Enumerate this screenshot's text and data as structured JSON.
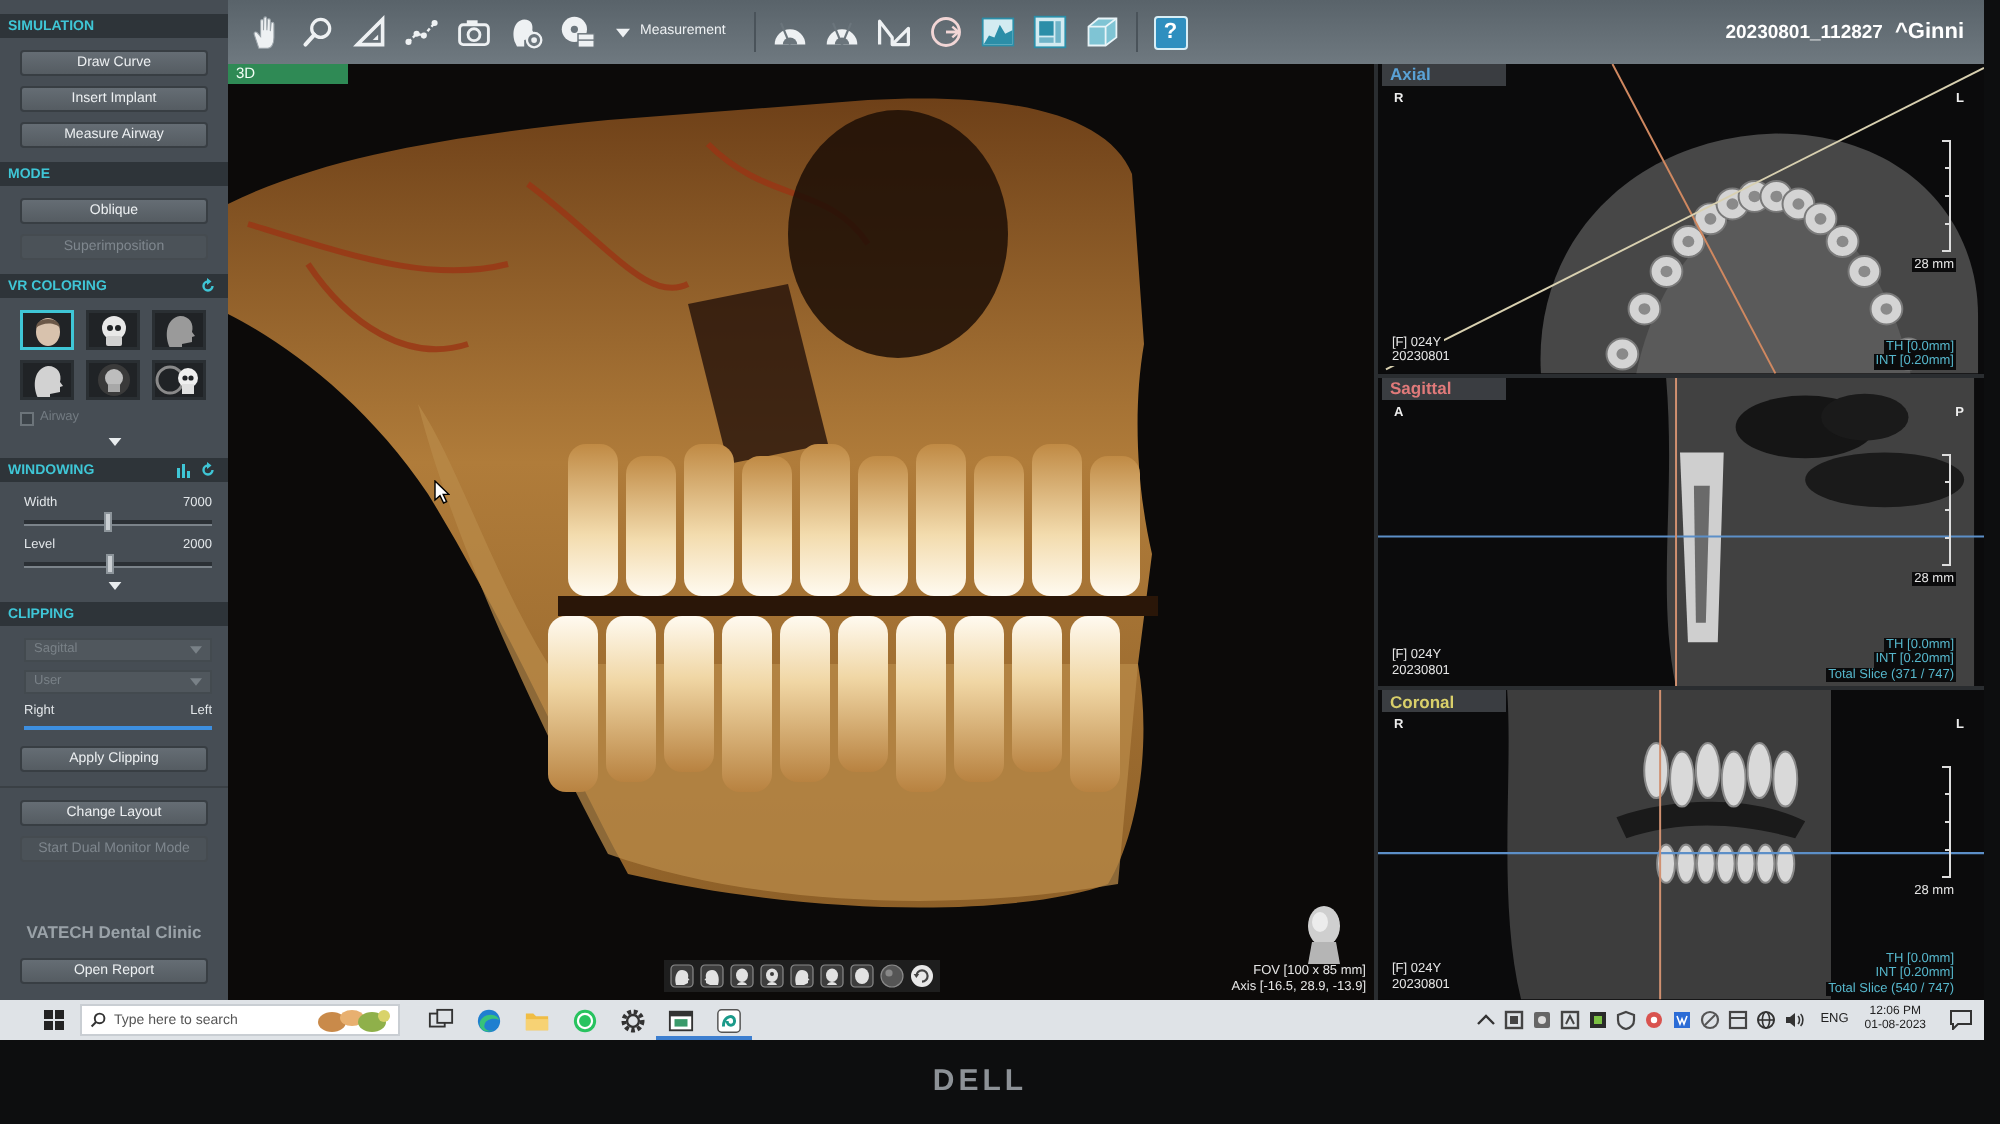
{
  "header": {
    "study": "20230801_112827",
    "patient": "^Ginni"
  },
  "toolbar": {
    "measurement_label": "Measurement",
    "help_glyph": "?"
  },
  "sidebar": {
    "sections": [
      {
        "title": "SIMULATION",
        "kind": "plain",
        "items": [
          {
            "kind": "button",
            "label": "Draw Curve",
            "disabled": false
          },
          {
            "kind": "button",
            "label": "Insert Implant",
            "disabled": false
          },
          {
            "kind": "button",
            "label": "Measure Airway",
            "disabled": false
          }
        ]
      },
      {
        "title": "MODE",
        "kind": "plain",
        "items": [
          {
            "kind": "button",
            "label": "Oblique",
            "disabled": false
          },
          {
            "kind": "button",
            "label": "Superimposition",
            "disabled": true
          }
        ]
      },
      {
        "title": "VR COLORING",
        "kind": "reset",
        "items": [
          {
            "kind": "presets",
            "presets": [
              {
                "selected": true
              },
              {
                "selected": false
              },
              {
                "selected": false
              },
              {
                "selected": false
              },
              {
                "selected": false
              },
              {
                "selected": false
              }
            ]
          },
          {
            "kind": "checkbox",
            "label": "Airway",
            "checked": false,
            "disabled": true
          },
          {
            "kind": "expander"
          }
        ]
      },
      {
        "title": "WINDOWING",
        "kind": "histogram_reset",
        "items": [
          {
            "kind": "slider",
            "label": "Width",
            "value": "7000",
            "level": 0.45
          },
          {
            "kind": "slider",
            "label": "Level",
            "value": "2000",
            "level": 0.46
          },
          {
            "kind": "expander"
          }
        ]
      },
      {
        "title": "CLIPPING",
        "kind": "plain",
        "items": [
          {
            "kind": "dropdown",
            "value": "Sagittal",
            "disabled": true
          },
          {
            "kind": "dropdown",
            "value": "User",
            "disabled": true
          },
          {
            "kind": "range",
            "start_label": "Right",
            "end_label": "Left"
          },
          {
            "kind": "button",
            "label": "Apply Clipping",
            "disabled": false
          }
        ]
      },
      {
        "items": [
          {
            "kind": "button",
            "label": "Change Layout",
            "disabled": false
          },
          {
            "kind": "button",
            "label": "Start Dual Monitor Mode",
            "disabled": true
          },
          {
            "kind": "caption",
            "label": "VATECH Dental Clinic"
          },
          {
            "kind": "button",
            "label": "Open Report",
            "disabled": false
          }
        ]
      }
    ]
  },
  "volume_view": {
    "title": "3D",
    "fov": "FOV [100 x 85 mm]",
    "axis": "Axis [-16.5, 28.9, -13.9]"
  },
  "slice_views": [
    {
      "kind": "axial",
      "title": "Axial",
      "color": "#5aa2d6",
      "orientation_left": "R",
      "orientation_right": "L",
      "scale": "28 mm",
      "patient": "[F] 024Y",
      "date": "20230801",
      "thickness": "TH [0.0mm]",
      "interval": "INT [0.20mm]"
    },
    {
      "kind": "sagittal",
      "title": "Sagittal",
      "color": "#e07a7a",
      "orientation_left": "A",
      "orientation_right": "P",
      "scale": "28 mm",
      "patient": "[F] 024Y",
      "date": "20230801",
      "thickness": "TH [0.0mm]",
      "interval": "INT [0.20mm]",
      "total_slice": "Total Slice (371 / 747)"
    },
    {
      "kind": "coronal",
      "title": "Coronal",
      "color": "#d9cf6a",
      "orientation_left": "R",
      "orientation_right": "L",
      "scale": "28 mm",
      "patient": "[F] 024Y",
      "date": "20230801",
      "thickness": "TH [0.0mm]",
      "interval": "INT [0.20mm]",
      "total_slice": "Total Slice (540 / 747)"
    }
  ],
  "taskbar": {
    "search_placeholder": "Type here to search",
    "apps": [
      {
        "kind": "task_view",
        "running": false
      },
      {
        "kind": "browser",
        "running": false
      },
      {
        "kind": "folder",
        "running": false
      },
      {
        "kind": "chat",
        "running": false
      },
      {
        "kind": "settings",
        "running": false
      },
      {
        "kind": "window",
        "running": true
      },
      {
        "kind": "app",
        "running": true
      }
    ],
    "language": "ENG",
    "time": "12:06 PM",
    "date": "01-08-2023"
  },
  "monitor": {
    "logo": "DELL"
  }
}
